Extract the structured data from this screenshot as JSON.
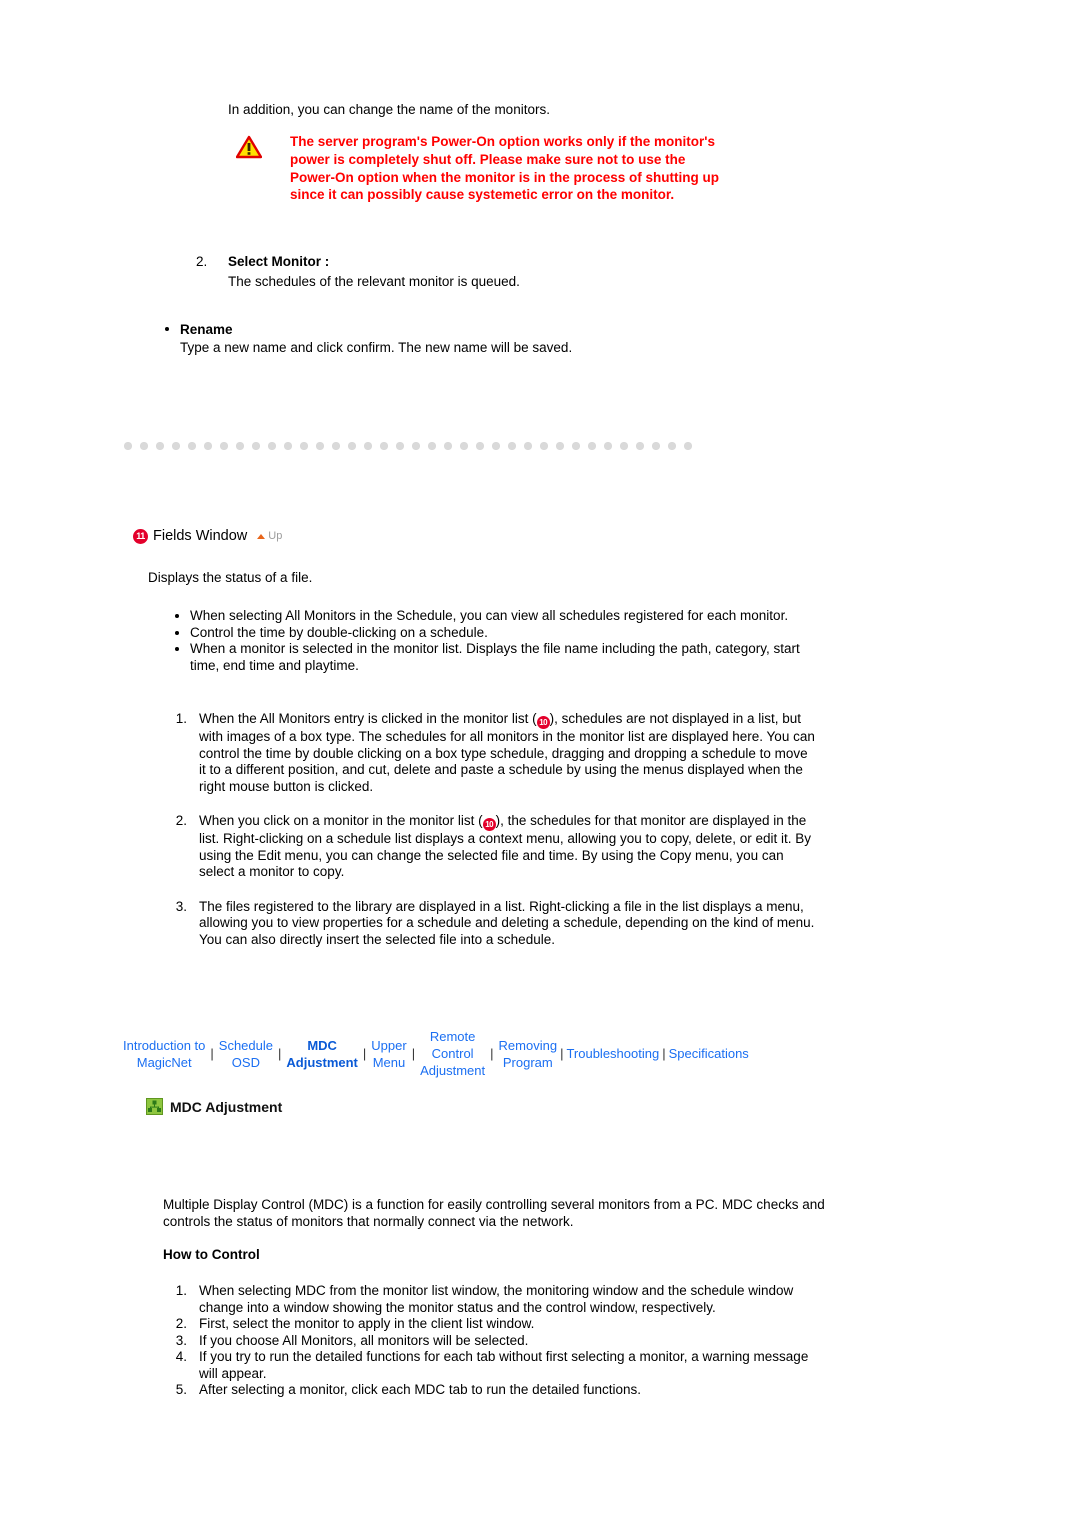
{
  "document": {
    "intro_line": "In addition, you can change the name of the monitors.",
    "warning": {
      "icon": "warning-triangle-icon",
      "text": "The server program's Power-On option works only if the monitor's power is completely shut off. Please make sure not to use the Power-On option when the monitor is in the process of shutting up since it can possibly cause systemetic error on the monitor.",
      "color": "#ff0000"
    },
    "select_monitor": {
      "number": "2.",
      "title": "Select Monitor :",
      "description": "The schedules of the relevant monitor is queued."
    },
    "rename": {
      "title": "Rename",
      "description": "Type a new name and click confirm. The new name will be saved."
    },
    "fields_window": {
      "badge": "11",
      "heading": "Fields Window",
      "up_label": "Up",
      "intro": "Displays the status of a file.",
      "bullets": [
        "When selecting All Monitors in the Schedule, you can view all schedules registered for each monitor.",
        "Control the time by double-clicking on a schedule.",
        "When a monitor is selected in the monitor list. Displays the file name including the path, category, start time, end time and playtime."
      ],
      "numbered": [
        {
          "number": "1.",
          "text_before": "When the All Monitors entry is clicked in the monitor list (",
          "inline_badge": "10",
          "text_after": "), schedules are not displayed in a list, but with images of a box type. The schedules for all monitors in the monitor list are displayed here. You can control the time by double clicking on a box type schedule, dragging and dropping a schedule to move it to a different position, and cut, delete and paste a schedule by using the menus displayed when the right mouse button is clicked."
        },
        {
          "number": "2.",
          "text_before": "When you click on a monitor in the monitor list (",
          "inline_badge": "10",
          "text_after": "), the schedules for that monitor are displayed in the list. Right-clicking on a schedule list displays a context menu, allowing you to copy, delete, or edit it. By using the Edit menu, you can change the selected file and time. By using the Copy menu, you can select a monitor to copy."
        },
        {
          "number": "3.",
          "text_before": "The files registered to the library are displayed in a list. Right-clicking a file in the list displays a menu, allowing you to view properties for a schedule and deleting a schedule, depending on the kind of menu. You can also directly insert the selected file into a schedule.",
          "inline_badge": "",
          "text_after": ""
        }
      ]
    },
    "navbar": {
      "accent_color": "#1b6ff2",
      "items": [
        {
          "label": "Introduction to\nMagicNet",
          "current": false
        },
        {
          "label": "Schedule\nOSD",
          "current": false
        },
        {
          "label": "MDC\nAdjustment",
          "current": true
        },
        {
          "label": "Upper\nMenu",
          "current": false
        },
        {
          "label": "Remote\nControl\nAdjustment",
          "current": false
        },
        {
          "label": "Removing\nProgram",
          "current": false
        },
        {
          "label": "Troubleshooting",
          "current": false
        },
        {
          "label": "Specifications",
          "current": false
        }
      ],
      "separator": "|"
    },
    "mdc": {
      "icon": "network-green-icon",
      "heading": "MDC Adjustment",
      "paragraph": "Multiple Display Control (MDC) is a function for easily controlling several monitors from a PC. MDC checks and controls the status of monitors that normally connect via the network.",
      "how_to_control_title": "How to Control",
      "steps": [
        {
          "number": "1.",
          "text": "When selecting MDC from the monitor list window, the monitoring window and the schedule window change into a window showing the monitor status and the control window, respectively."
        },
        {
          "number": "2.",
          "text": "First, select the monitor to apply in the client list window."
        },
        {
          "number": "3.",
          "text": "If you choose All Monitors, all monitors will be selected."
        },
        {
          "number": "4.",
          "text": "If you try to run the detailed functions for each tab without first selecting a monitor, a warning message will appear."
        },
        {
          "number": "5.",
          "text": "After selecting a monitor, click each MDC tab to run the detailed functions."
        }
      ]
    }
  }
}
